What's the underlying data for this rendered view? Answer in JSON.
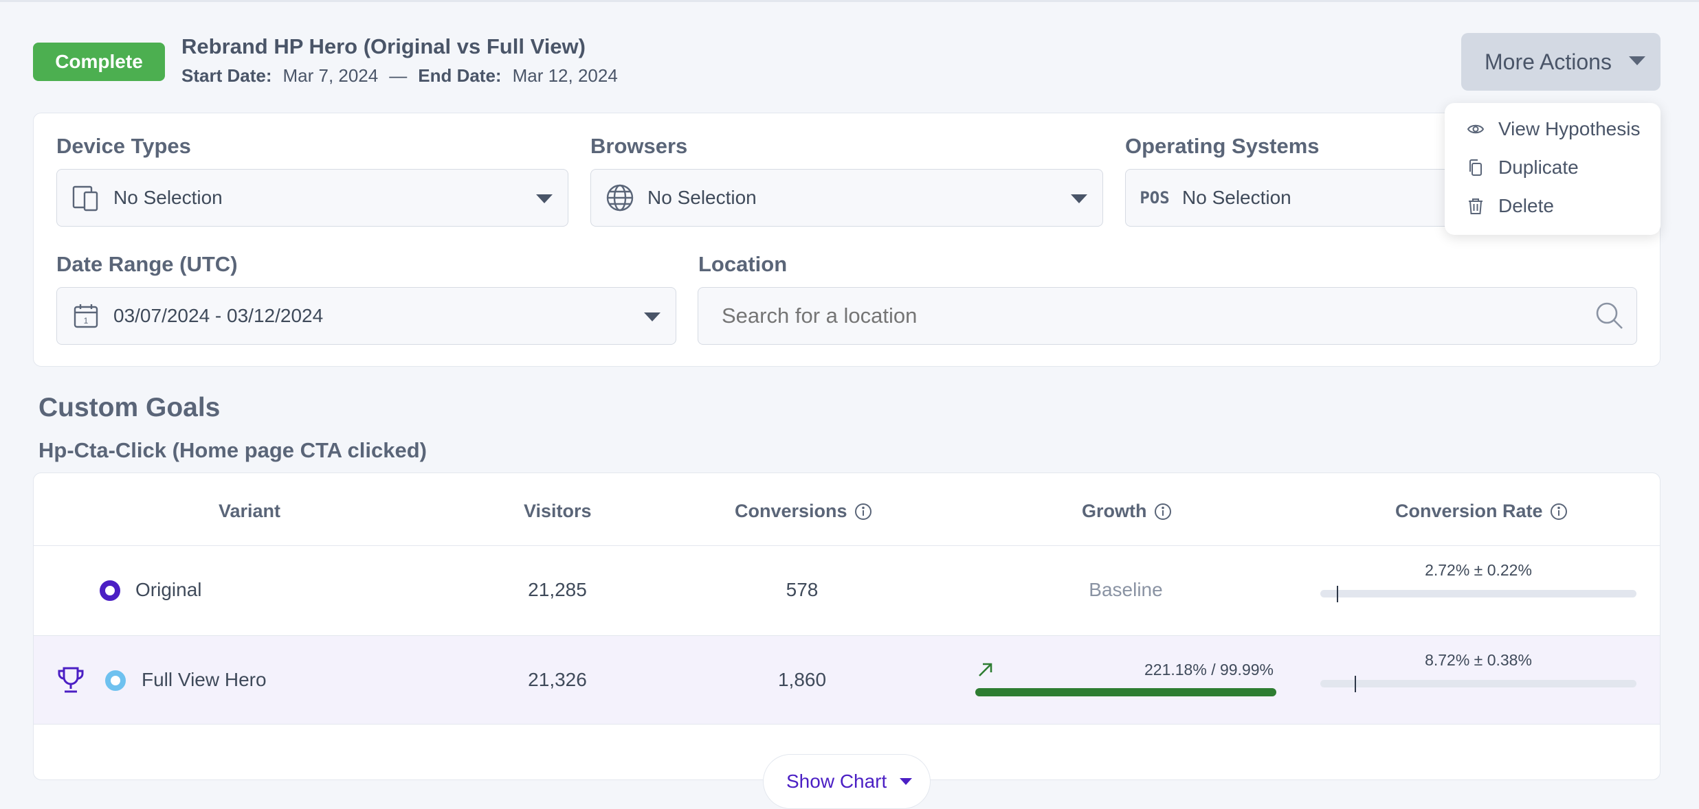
{
  "experiment": {
    "status": "Complete",
    "title": "Rebrand HP Hero (Original vs Full View)",
    "start_label": "Start Date:",
    "start_date": "Mar 7, 2024",
    "separator": "—",
    "end_label": "End Date:",
    "end_date": "Mar 12, 2024"
  },
  "actions": {
    "button_label": "More Actions",
    "menu": [
      {
        "label": "View Hypothesis",
        "icon": "eye-icon"
      },
      {
        "label": "Duplicate",
        "icon": "copy-icon"
      },
      {
        "label": "Delete",
        "icon": "trash-icon"
      }
    ]
  },
  "filters": {
    "device_types": {
      "label": "Device Types",
      "value": "No Selection",
      "icon": "devices-icon"
    },
    "browsers": {
      "label": "Browsers",
      "value": "No Selection",
      "icon": "globe-icon"
    },
    "operating_systems": {
      "label": "Operating Systems",
      "value": "No Selection",
      "icon_text": "POS"
    },
    "date_range": {
      "label": "Date Range (UTC)",
      "value": "03/07/2024 - 03/12/2024",
      "icon": "calendar-icon",
      "icon_text": "1"
    },
    "location": {
      "label": "Location",
      "placeholder": "Search for a location"
    }
  },
  "goals": {
    "section_title": "Custom Goals",
    "goal_title": "Hp-Cta-Click (Home page CTA clicked)",
    "columns": [
      "Variant",
      "Visitors",
      "Conversions",
      "Growth",
      "Conversion Rate"
    ],
    "rows": [
      {
        "variant": "Original",
        "visitors": "21,285",
        "conversions": "578",
        "growth": "Baseline",
        "conversion_rate": "2.72% ± 0.22%",
        "conversion_rate_value": 2.72,
        "radio_color": "#4b1fc4",
        "winner": false
      },
      {
        "variant": "Full View Hero",
        "visitors": "21,326",
        "conversions": "1,860",
        "growth": "221.18% / 99.99%",
        "growth_probability_pct": 99.99,
        "conversion_rate": "8.72% ± 0.38%",
        "conversion_rate_value": 8.72,
        "radio_color": "#6ec1ef",
        "winner": true
      }
    ],
    "show_chart_label": "Show Chart"
  },
  "colors": {
    "status_green": "#4caf50",
    "accent_purple": "#4b1fc4",
    "growth_green": "#2e7d32"
  }
}
